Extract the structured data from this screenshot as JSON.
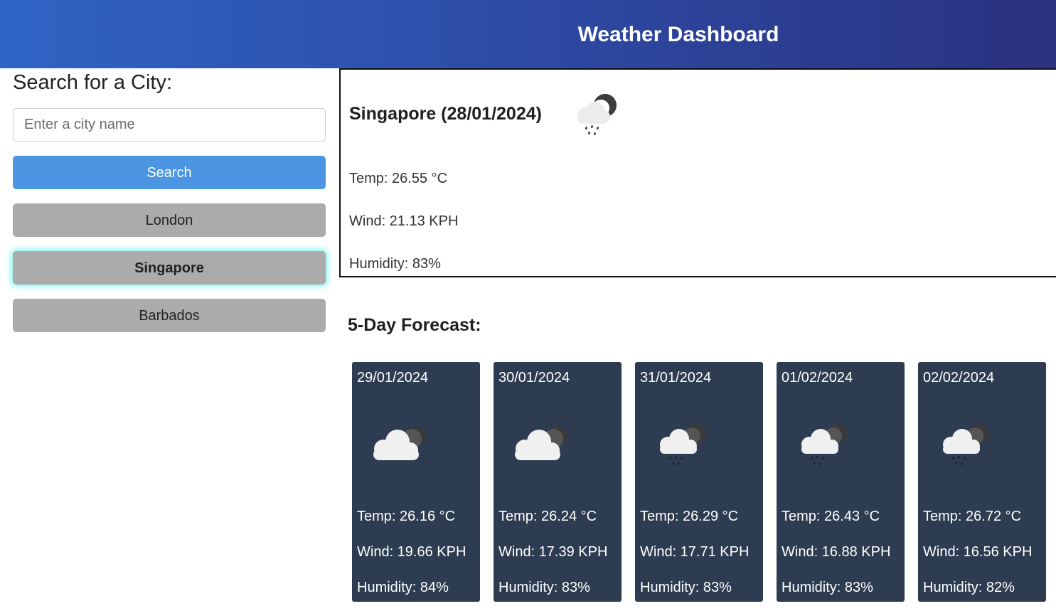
{
  "header": {
    "title": "Weather Dashboard"
  },
  "sidebar": {
    "heading": "Search for a City:",
    "search_placeholder": "Enter a city name",
    "search_label": "Search",
    "history": [
      {
        "label": "London",
        "active": false
      },
      {
        "label": "Singapore",
        "active": true
      },
      {
        "label": "Barbados",
        "active": false
      }
    ]
  },
  "current": {
    "title": "Singapore (28/01/2024)",
    "icon": "rain-cloud-night-icon",
    "temp": "Temp: 26.55 °C",
    "wind": "Wind: 21.13 KPH",
    "humidity": "Humidity: 83%"
  },
  "forecast": {
    "heading": "5-Day Forecast:",
    "days": [
      {
        "date": "29/01/2024",
        "icon": "cloudy-night-icon",
        "temp": "Temp: 26.16 °C",
        "wind": "Wind: 19.66 KPH",
        "humidity": "Humidity: 84%"
      },
      {
        "date": "30/01/2024",
        "icon": "cloudy-night-icon",
        "temp": "Temp: 26.24 °C",
        "wind": "Wind: 17.39 KPH",
        "humidity": "Humidity: 83%"
      },
      {
        "date": "31/01/2024",
        "icon": "rain-cloud-night-icon",
        "temp": "Temp: 26.29 °C",
        "wind": "Wind: 17.71 KPH",
        "humidity": "Humidity: 83%"
      },
      {
        "date": "01/02/2024",
        "icon": "rain-cloud-night-icon",
        "temp": "Temp: 26.43 °C",
        "wind": "Wind: 16.88 KPH",
        "humidity": "Humidity: 83%"
      },
      {
        "date": "02/02/2024",
        "icon": "rain-cloud-night-icon",
        "temp": "Temp: 26.72 °C",
        "wind": "Wind: 16.56 KPH",
        "humidity": "Humidity: 82%"
      }
    ]
  },
  "colors": {
    "header_start": "#2f64c4",
    "header_end": "#2a317f",
    "search_button": "#4c95e3",
    "history_button": "#ababab",
    "active_glow": "#8ff4f4",
    "card_bg": "#2d3c50"
  }
}
